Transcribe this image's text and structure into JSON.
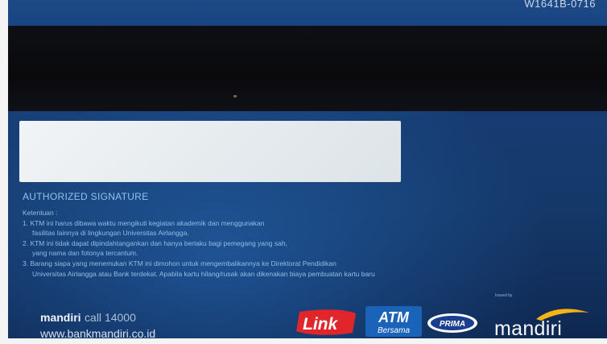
{
  "card": {
    "serial_number": "W1641B-0716",
    "signature_label": "AUTHORIZED SIGNATURE",
    "terms_heading": "Ketentuan :",
    "terms_lines": [
      "1. KTM ini harus dibawa waktu mengikuti kegiatan akademik dan menggunakan",
      "fasilitas lainnya di lingkungan Universitas Airlangga.",
      "2. KTM ini tidak dapat dipindahtangankan dan hanya berlaku bagi pemegang yang sah,",
      "yang nama dan fotonya tercantum.",
      "3. Barang siapa yang menemukan KTM ini dimohon untuk mengembalikannya ke Direktorat Pendidikan",
      "Universitas Airlangga atau Bank terdekat. Apabila kartu hilang/rusak akan dikenakan biaya pembuatan kartu baru"
    ],
    "fine_print": "Issued by",
    "bank_brand": "mandiri",
    "call_text": "call 14000",
    "website": "www.bankmandiri.co.id"
  },
  "logos": {
    "link": "Link",
    "atm_top": "ATM",
    "atm_bottom": "Bersama",
    "prima": "PRIMA",
    "mandiri": "mandiri"
  },
  "colors": {
    "card_blue": "#173c72",
    "link_red": "#e0252b",
    "atm_blue": "#1a63b8",
    "mandiri_gold": "#f3b414"
  }
}
